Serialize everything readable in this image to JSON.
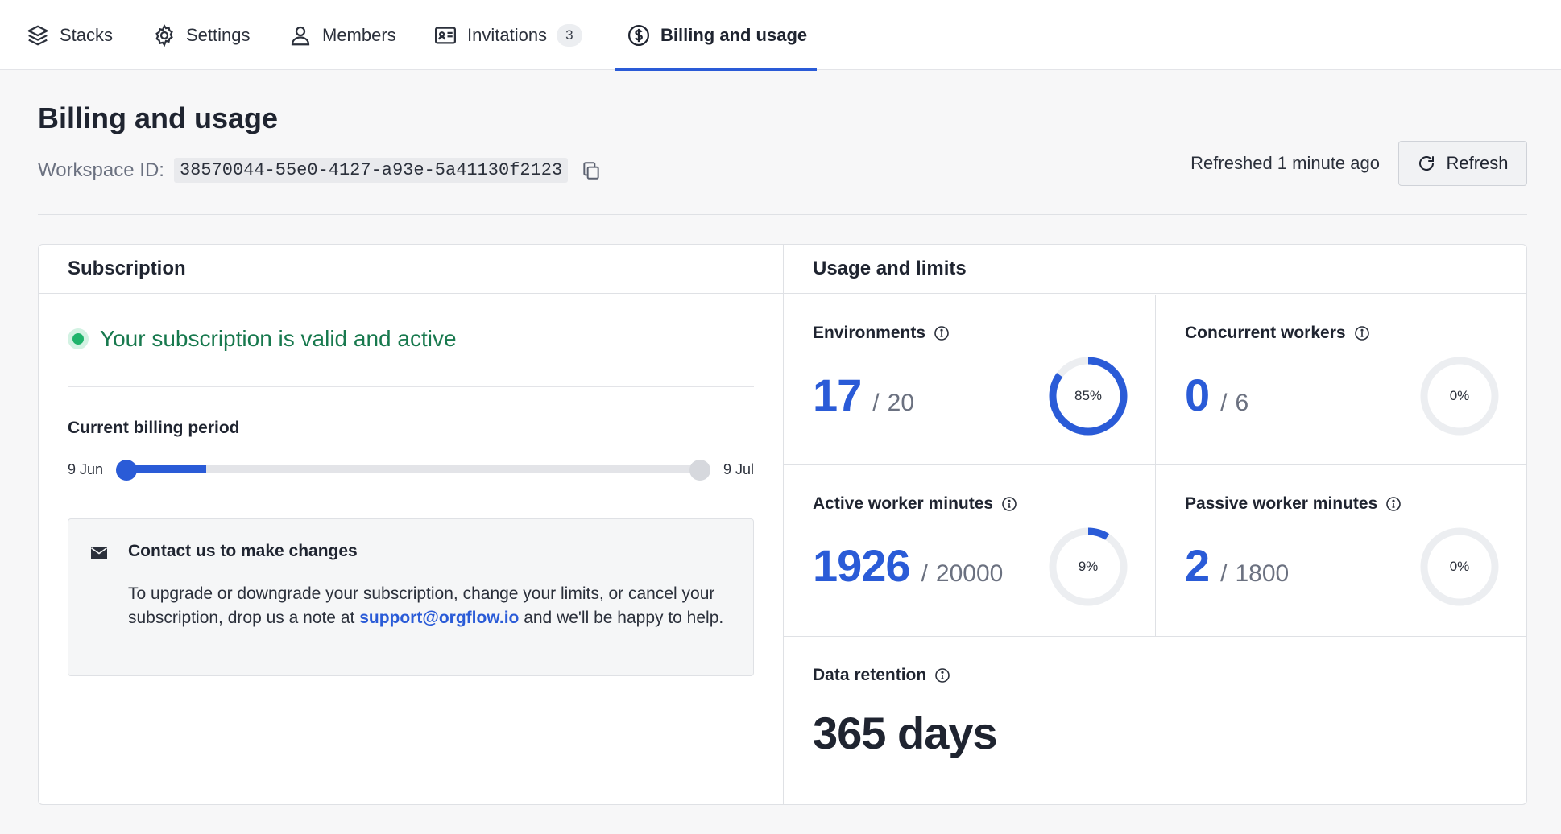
{
  "nav": {
    "tabs": [
      {
        "label": "Stacks",
        "icon": "layers-icon"
      },
      {
        "label": "Settings",
        "icon": "gear-icon"
      },
      {
        "label": "Members",
        "icon": "user-icon"
      },
      {
        "label": "Invitations",
        "icon": "id-card-icon",
        "badge": "3"
      },
      {
        "label": "Billing and usage",
        "icon": "dollar-circle-icon",
        "active": true
      }
    ]
  },
  "page": {
    "title": "Billing and usage",
    "workspace_label": "Workspace ID:",
    "workspace_id": "38570044-55e0-4127-a93e-5a41130f2123",
    "refreshed_text": "Refreshed 1 minute ago",
    "refresh_label": "Refresh"
  },
  "subscription": {
    "heading": "Subscription",
    "status": "Your subscription is valid and active",
    "billing_label": "Current billing period",
    "period_start": "9 Jun",
    "period_end": "9 Jul",
    "period_progress": 0.14,
    "contact_title": "Contact us to make changes",
    "contact_text_before": "To upgrade or downgrade your subscription, change your limits, or cancel your subscription, drop us a note at",
    "contact_email": "support@orgflow.io",
    "contact_text_after": "and we'll be happy to help."
  },
  "usage": {
    "heading": "Usage and limits",
    "environments": {
      "title": "Environments",
      "value": "17",
      "limit": "20",
      "percent_label": "85%",
      "fraction": 0.85
    },
    "concurrent_workers": {
      "title": "Concurrent workers",
      "value": "0",
      "limit": "6",
      "percent_label": "0%",
      "fraction": 0
    },
    "active_minutes": {
      "title": "Active worker minutes",
      "value": "1926",
      "limit": "20000",
      "percent_label": "9%",
      "fraction": 0.09
    },
    "passive_minutes": {
      "title": "Passive worker minutes",
      "value": "2",
      "limit": "1800",
      "percent_label": "0%",
      "fraction": 0
    },
    "retention": {
      "title": "Data retention",
      "value": "365 days"
    }
  },
  "colors": {
    "accent": "#2a5bd7",
    "success": "#18794e",
    "track": "#e3e4e8"
  }
}
